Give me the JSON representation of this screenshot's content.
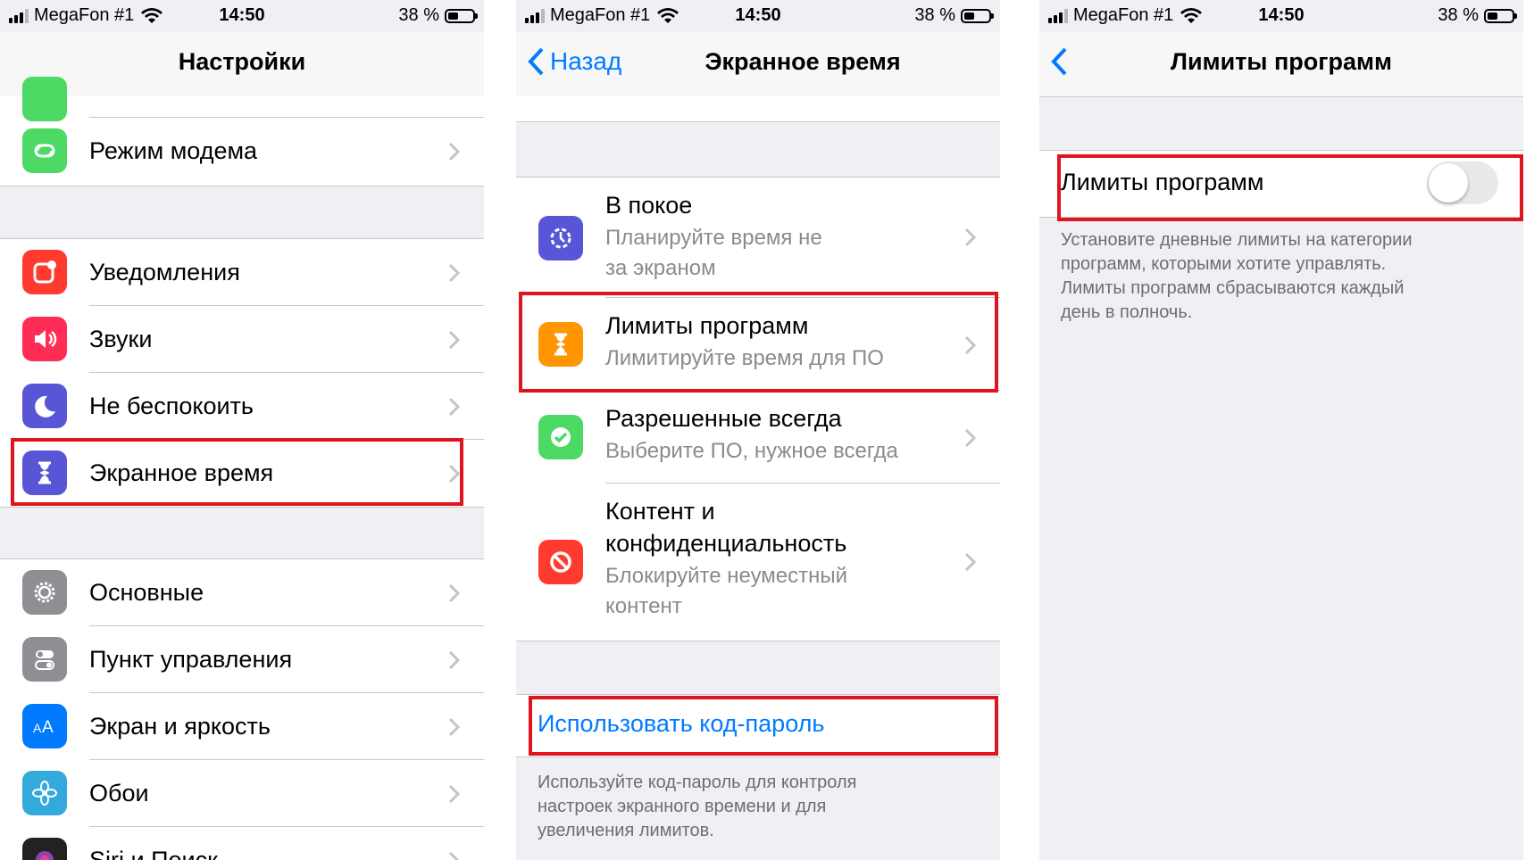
{
  "status": {
    "carrier": "MegaFon #1",
    "time": "14:50",
    "battery": "38 %"
  },
  "colors": {
    "accent": "#007aff",
    "highlight": "#e0141e"
  },
  "panel1": {
    "title": "Настройки",
    "items": [
      {
        "label": "Режим модема",
        "icon": "link-icon",
        "color": "#4cd964"
      },
      {
        "label": "Уведомления",
        "icon": "notifications-icon",
        "color": "#ff3b30"
      },
      {
        "label": "Звуки",
        "icon": "speaker-icon",
        "color": "#ff2d55"
      },
      {
        "label": "Не беспокоить",
        "icon": "moon-icon",
        "color": "#5856d6"
      },
      {
        "label": "Экранное время",
        "icon": "hourglass-icon",
        "color": "#5856d6"
      },
      {
        "label": "Основные",
        "icon": "gear-icon",
        "color": "#8e8e93"
      },
      {
        "label": "Пункт управления",
        "icon": "switches-icon",
        "color": "#8e8e93"
      },
      {
        "label": "Экран и яркость",
        "icon": "text-size-icon",
        "color": "#007aff"
      },
      {
        "label": "Обои",
        "icon": "flower-icon",
        "color": "#34aadc"
      },
      {
        "label": "Siri и Поиск",
        "icon": "siri-icon",
        "color": "#222222"
      }
    ]
  },
  "panel2": {
    "back": "Назад",
    "title": "Экранное время",
    "items": [
      {
        "label": "В покое",
        "sub1": "Планируйте время не",
        "sub2": "за экраном",
        "icon": "downtime-icon",
        "color": "#5856d6"
      },
      {
        "label": "Лимиты программ",
        "sub1": "Лимитируйте время для ПО",
        "icon": "hourglass-icon",
        "color": "#ff9500"
      },
      {
        "label": "Разрешенные всегда",
        "sub1": "Выберите ПО, нужное всегда",
        "icon": "checkmark-badge-icon",
        "color": "#4cd964"
      },
      {
        "label": "Контент и",
        "label2": "конфиденциальность",
        "sub1": "Блокируйте неуместный",
        "sub2": "контент",
        "icon": "restrict-icon",
        "color": "#ff3b30"
      }
    ],
    "passcode_link": "Использовать код-пароль",
    "footer": [
      "Используйте код-пароль для контроля",
      "настроек экранного времени и для",
      "увеличения лимитов."
    ]
  },
  "panel3": {
    "title": "Лимиты программ",
    "toggle_label": "Лимиты программ",
    "toggle_on": false,
    "footer": [
      "Установите дневные лимиты на категории",
      "программ, которыми хотите управлять.",
      "Лимиты программ сбрасываются каждый",
      "день в полночь."
    ]
  }
}
